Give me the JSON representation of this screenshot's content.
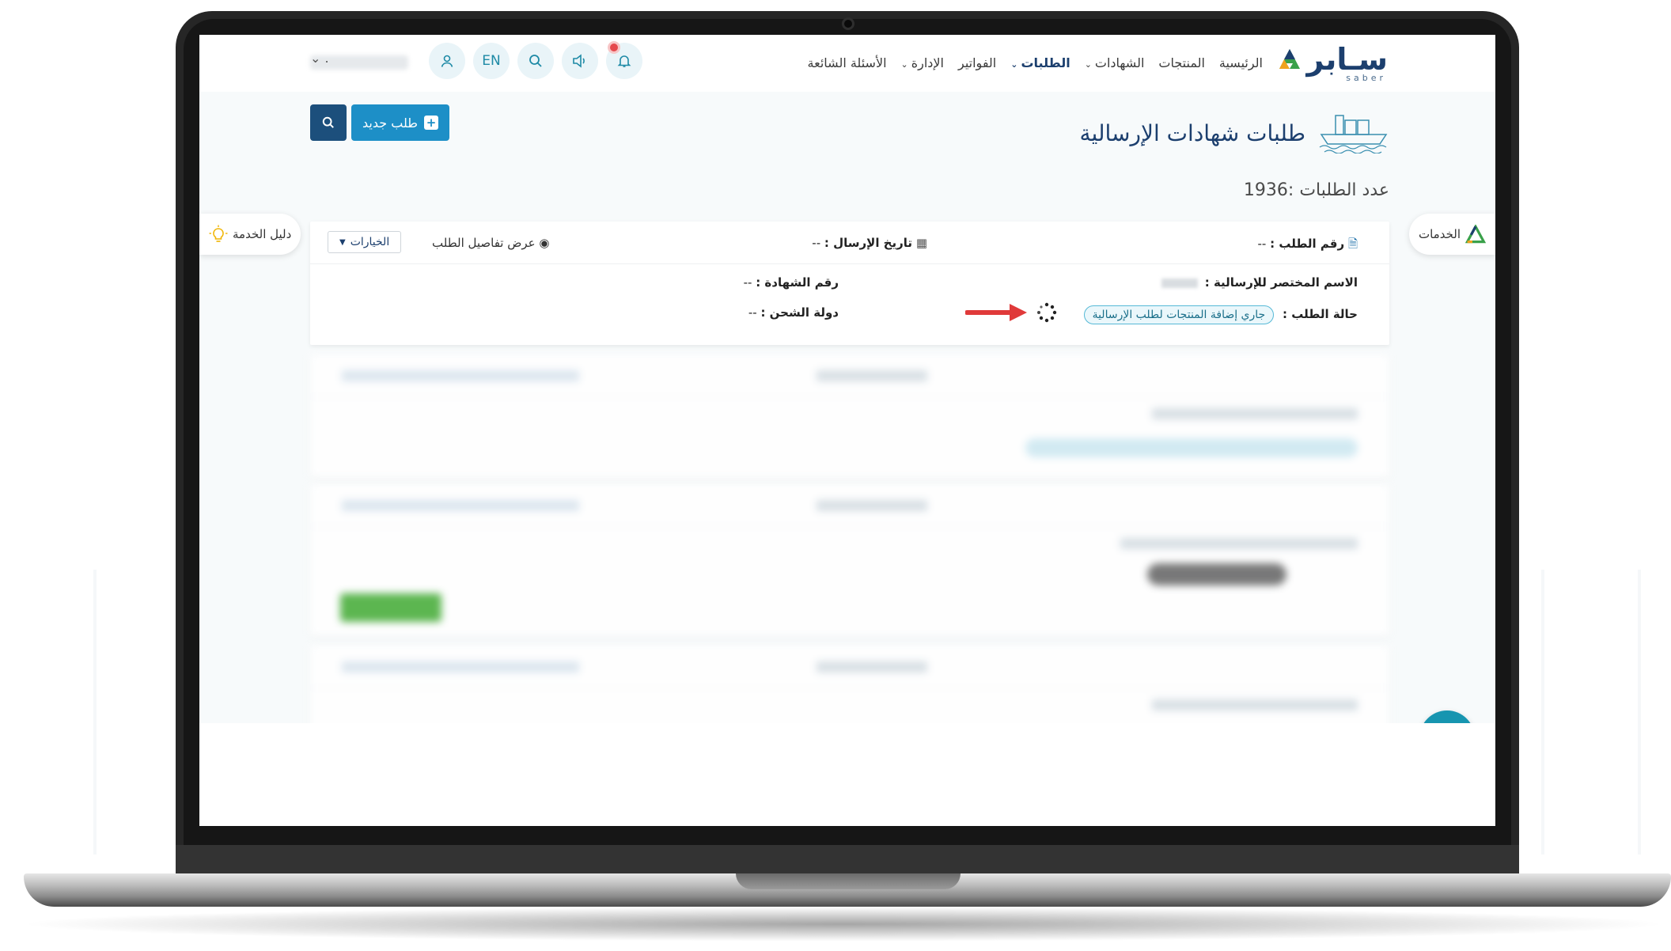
{
  "nav": {
    "logo_text": "سـابر",
    "logo_sub": "saber",
    "menu": [
      {
        "label": "الرئيسية",
        "dropdown": false,
        "active": false
      },
      {
        "label": "المنتجات",
        "dropdown": false,
        "active": false
      },
      {
        "label": "الشهادات",
        "dropdown": true,
        "active": false
      },
      {
        "label": "الطلبات",
        "dropdown": true,
        "active": true
      },
      {
        "label": "الفواتير",
        "dropdown": false,
        "active": false
      },
      {
        "label": "الإدارة",
        "dropdown": true,
        "active": false
      },
      {
        "label": "الأسئلة الشائعة",
        "dropdown": false,
        "active": false
      }
    ],
    "lang_label": "EN",
    "user_dot": "."
  },
  "page": {
    "title": "طلبات شهادات الإرسالية",
    "new_request_label": "طلب جديد",
    "count_label": "عدد الطلبات :1936"
  },
  "side": {
    "services_label": "الخدمات",
    "guide_label": "دليل الخدمة"
  },
  "card": {
    "request_number_label": "رقم الطلب :",
    "request_number_value": "--",
    "send_date_label": "تاريخ الإرسال :",
    "send_date_value": "--",
    "view_details_label": "عرض تفاصيل الطلب",
    "options_label": "الخيارات",
    "short_name_label": "الاسم المختصر للإرسالية :",
    "certificate_number_label": "رقم الشهادة :",
    "certificate_number_value": "--",
    "status_label": "حالة الطلب :",
    "status_value": "جاري إضافة المنتجات لطلب الإرسالية",
    "shipping_country_label": "دولة الشحن :",
    "shipping_country_value": "--"
  },
  "colors": {
    "brand_navy": "#1c3f6e",
    "accent_teal": "#1795b0",
    "button_blue": "#1d8fc7",
    "status_pill": "#56b9d6",
    "arrow_red": "#e03a3a"
  }
}
